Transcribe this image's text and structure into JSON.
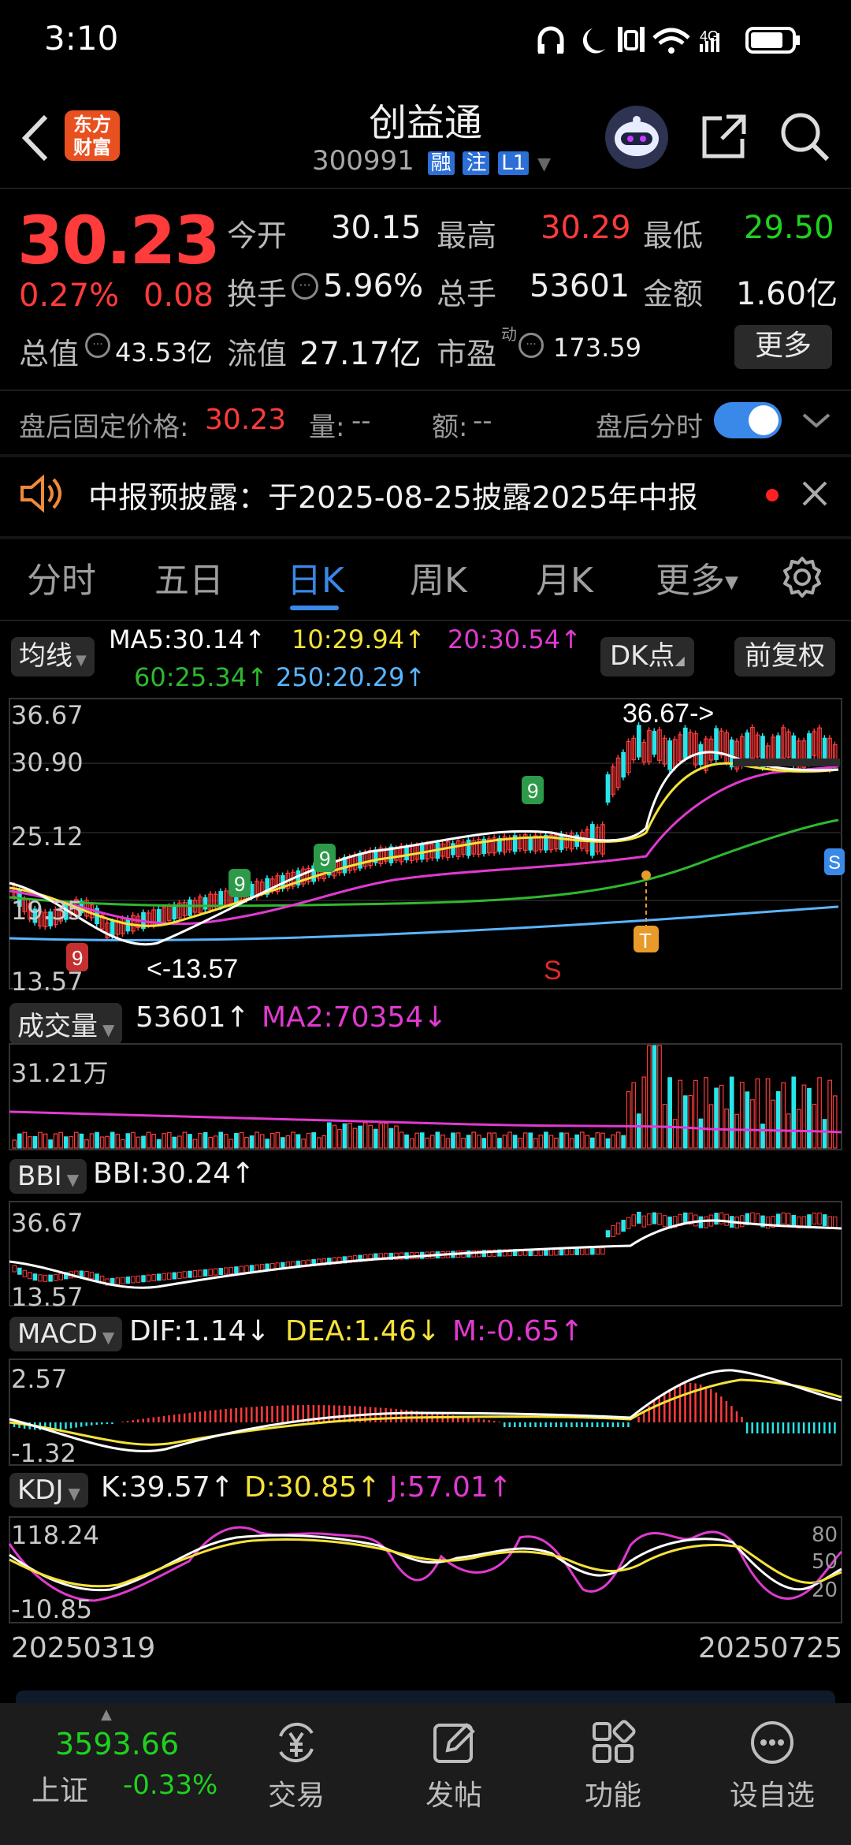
{
  "status": {
    "time": "3:10",
    "network": "4G"
  },
  "header": {
    "title": "创益通",
    "code": "300991",
    "tags": [
      "融",
      "注",
      "L1"
    ],
    "logo_text": "东方\n财富"
  },
  "quote": {
    "price": "30.23",
    "change_pct": "0.27%",
    "change_val": "0.08",
    "rows": [
      [
        {
          "k": "今开",
          "v": "30.15",
          "c": "white"
        },
        {
          "k": "最高",
          "v": "30.29",
          "c": "red"
        },
        {
          "k": "最低",
          "v": "29.50",
          "c": "green"
        }
      ],
      [
        {
          "k": "换手",
          "v": "5.96%",
          "c": "white"
        },
        {
          "k": "总手",
          "v": "53601",
          "c": "white"
        },
        {
          "k": "金额",
          "v": "1.60亿",
          "c": "white"
        }
      ]
    ],
    "total_value_label": "总值",
    "total_value": "43.53亿",
    "float_value_label": "流值",
    "float_value": "27.17亿",
    "pe_label": "市盈",
    "pe_sup": "动",
    "pe": "173.59",
    "more": "更多"
  },
  "after_hours": {
    "price_label": "盘后固定价格:",
    "price": "30.23",
    "vol_label": "量:",
    "vol": "--",
    "amt_label": "额:",
    "amt": "--",
    "toggle_label": "盘后分时",
    "toggle_on": true
  },
  "notice": {
    "text": "中报预披露：于2025-08-25披露2025年中报"
  },
  "tabs": [
    "分时",
    "五日",
    "日K",
    "周K",
    "月K",
    "更多"
  ],
  "active_tab": "日K",
  "ma": {
    "btn": "均线",
    "ma5": "MA5:30.14↑",
    "ma10": "10:29.94↑",
    "ma20": "20:30.54↑",
    "ma60": "60:25.34↑",
    "ma250": "250:20.29↑",
    "dk": "DK点",
    "fq": "前复权"
  },
  "kline": {
    "y_top": "36.67",
    "y_mid1": "30.90",
    "y_mid2": "25.12",
    "y_low": "19.35",
    "y_bot": "13.57",
    "max_label": "36.67->",
    "min_label": "<-13.57",
    "s_mark": "S",
    "t_mark": "T",
    "nines": [
      "9",
      "9",
      "9",
      "9"
    ]
  },
  "volume": {
    "btn": "成交量",
    "val": "53601↑",
    "ma2": "MA2:70354↓",
    "y_top": "31.21万"
  },
  "bbi": {
    "btn": "BBI",
    "val": "BBI:30.24↑",
    "y_top": "36.67",
    "y_bot": "13.57"
  },
  "macd": {
    "btn": "MACD",
    "dif": "DIF:1.14↓",
    "dea": "DEA:1.46↓",
    "m": "M:-0.65↑",
    "y_top": "2.57",
    "y_bot": "-1.32"
  },
  "kdj": {
    "btn": "KDJ",
    "k": "K:39.57↑",
    "d": "D:30.85↑",
    "j": "J:57.01↑",
    "y_top": "118.24",
    "y_bot": "-10.85",
    "r80": "80",
    "r50": "50",
    "r20": "20"
  },
  "dates": {
    "start": "20250319",
    "end": "20250725"
  },
  "bottom_nav": {
    "index_value": "3593.66",
    "index_name": "上证",
    "index_change": "-0.33%",
    "items": [
      "交易",
      "发帖",
      "功能",
      "设自选"
    ]
  },
  "colors": {
    "up": "#ff3b3b",
    "down": "#1fd11f",
    "accent": "#3a88e8",
    "bg": "#000000"
  }
}
